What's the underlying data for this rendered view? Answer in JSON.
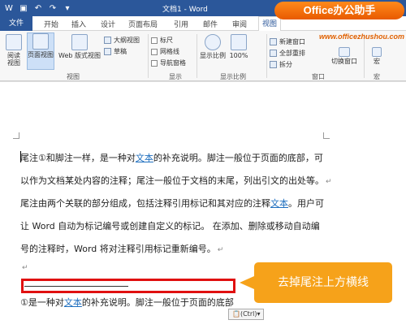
{
  "title_bar": {
    "doc_title": "文档1 - Word",
    "qat_icons": [
      "word-app-icon",
      "save-icon",
      "undo-icon",
      "redo-icon",
      "customize-qat-icon"
    ]
  },
  "tabs": [
    "文件",
    "开始",
    "插入",
    "设计",
    "页面布局",
    "引用",
    "邮件",
    "审阅",
    "视图"
  ],
  "active_tab": "视图",
  "brand": {
    "name": "Office办公助手",
    "url": "www.officezhushou.com"
  },
  "ribbon": {
    "views": {
      "read_mode": "阅读\n视图",
      "print_layout": "页面视图",
      "web_layout": "Web 版式视图",
      "outline": "大纲视图",
      "draft": "草稿",
      "group_label": "视图"
    },
    "show": {
      "ruler": "标尺",
      "gridlines": "网格线",
      "nav_pane": "导航窗格",
      "group_label": "显示"
    },
    "zoom": {
      "zoom": "显示比例",
      "percent": "100%",
      "group_label": "显示比例"
    },
    "window": {
      "new_window": "新建窗口",
      "arrange_all": "全部重排",
      "split": "拆分",
      "switch_windows": "切换窗口",
      "group_label": "窗口"
    },
    "macros": {
      "label": "宏",
      "group_label": "宏"
    }
  },
  "document": {
    "lines": [
      [
        "尾注①和脚注一样，是一种对",
        "文本",
        "的补充说明。脚注一般位于页面的底部，可"
      ],
      [
        "以作为文档某处内容的注释；尾注一般位于文档的末尾，列出引文的出处等。",
        "",
        ""
      ],
      [
        "尾注由两个关联的部分组成，包括注释引用标记和其对应的注释",
        "文本",
        "。用户可"
      ],
      [
        "让 Word 自动为标记编号或创建自定义的标记。 在添加、删除或移动自动编",
        "",
        ""
      ],
      [
        "号的注释时，Word 将对注释引用标记重新编号。",
        "",
        ""
      ]
    ],
    "endnote": [
      "①是一种对",
      "文本",
      "的补充说明。脚注一般位于页面的底部"
    ],
    "paste_options": "(Ctrl)"
  },
  "callout": {
    "text": "去掉尾注上方横线"
  }
}
